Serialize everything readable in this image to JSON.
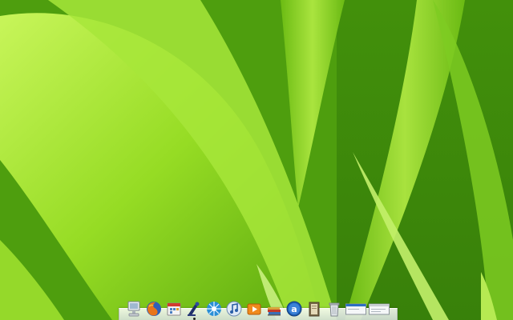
{
  "desktop": {
    "accent": "#8fd81c"
  },
  "dock": {
    "items": [
      {
        "id": "finder",
        "icon": "computer-icon"
      },
      {
        "id": "firefox",
        "icon": "firefox-icon"
      },
      {
        "id": "calendar",
        "icon": "calendar-icon"
      },
      {
        "id": "terminal",
        "icon": "terminal-icon",
        "running": true
      },
      {
        "id": "network",
        "icon": "network-icon"
      },
      {
        "id": "itunes",
        "icon": "music-note-icon"
      },
      {
        "id": "media",
        "icon": "media-player-icon"
      },
      {
        "id": "books",
        "icon": "books-icon"
      },
      {
        "id": "appstore",
        "icon": "app-store-icon"
      },
      {
        "id": "documents",
        "icon": "documents-icon"
      },
      {
        "id": "trash",
        "icon": "trash-icon"
      },
      {
        "id": "window1",
        "icon": "window-thumbnail-icon"
      },
      {
        "id": "window2",
        "icon": "window-thumbnail-icon"
      }
    ]
  }
}
